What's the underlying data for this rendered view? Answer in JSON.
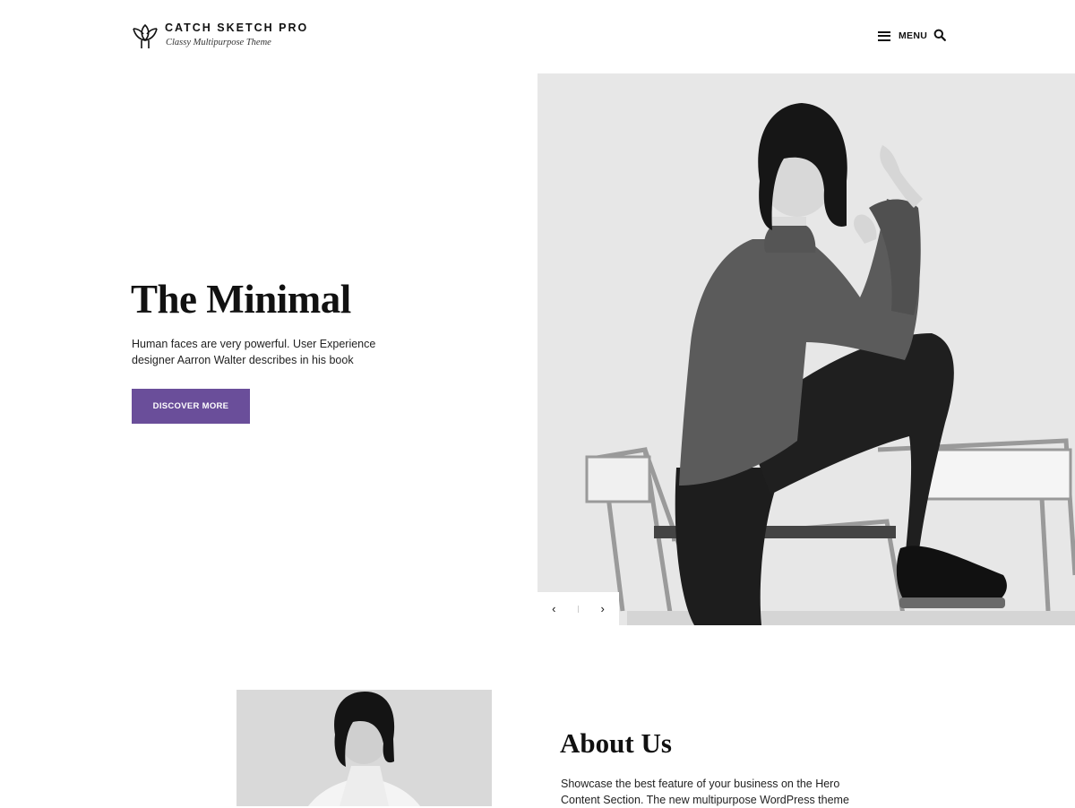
{
  "header": {
    "site_title": "CATCH SKETCH PRO",
    "tagline": "Classy Multipurpose Theme",
    "menu_label": "MENU",
    "logo_icon": "lotus-logo-icon",
    "menu_icon": "hamburger-icon",
    "search_icon": "search-icon"
  },
  "hero": {
    "title": "The Minimal",
    "description": "Human faces are very powerful. User Experience designer Aarron Walter describes in his book",
    "button_label": "DISCOVER MORE",
    "button_color": "#6a4e9a",
    "prev_symbol": "‹",
    "next_symbol": "›"
  },
  "about": {
    "title": "About Us",
    "text": "Showcase the best feature of your business on the Hero Content Section. The new multipurpose WordPress theme"
  }
}
